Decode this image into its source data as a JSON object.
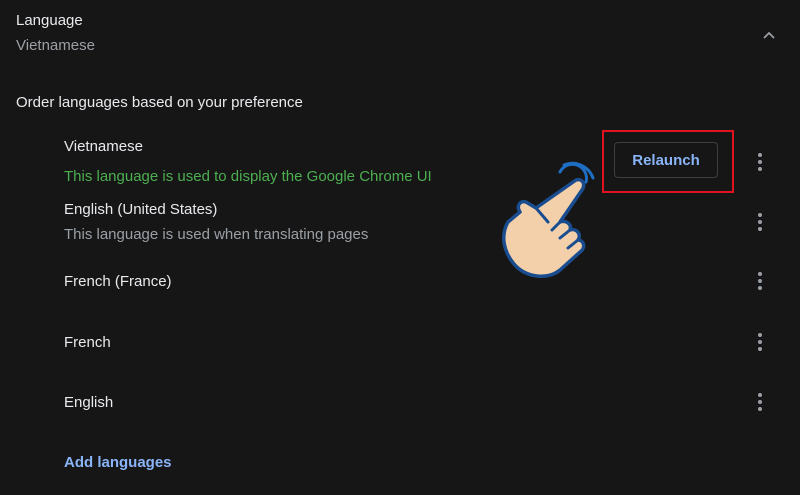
{
  "section": {
    "title": "Language",
    "subtitle": "Vietnamese"
  },
  "order_label": "Order languages based on your preference",
  "languages": [
    {
      "name": "Vietnamese",
      "description": "This language is used to display the Google Chrome UI"
    },
    {
      "name": "English (United States)",
      "description": "This language is used when translating pages"
    },
    {
      "name": "French (France)",
      "description": ""
    },
    {
      "name": "French",
      "description": ""
    },
    {
      "name": "English",
      "description": ""
    }
  ],
  "relaunch_label": "Relaunch",
  "add_languages_label": "Add languages",
  "icons": {
    "collapse": "chevron-up-icon",
    "more": "more-vert-icon",
    "pointer": "pointing-hand-icon"
  },
  "colors": {
    "background": "#161616",
    "accent": "#8ab4f8",
    "ui_language_note": "#4caf50",
    "highlight_box": "#e0141e"
  }
}
